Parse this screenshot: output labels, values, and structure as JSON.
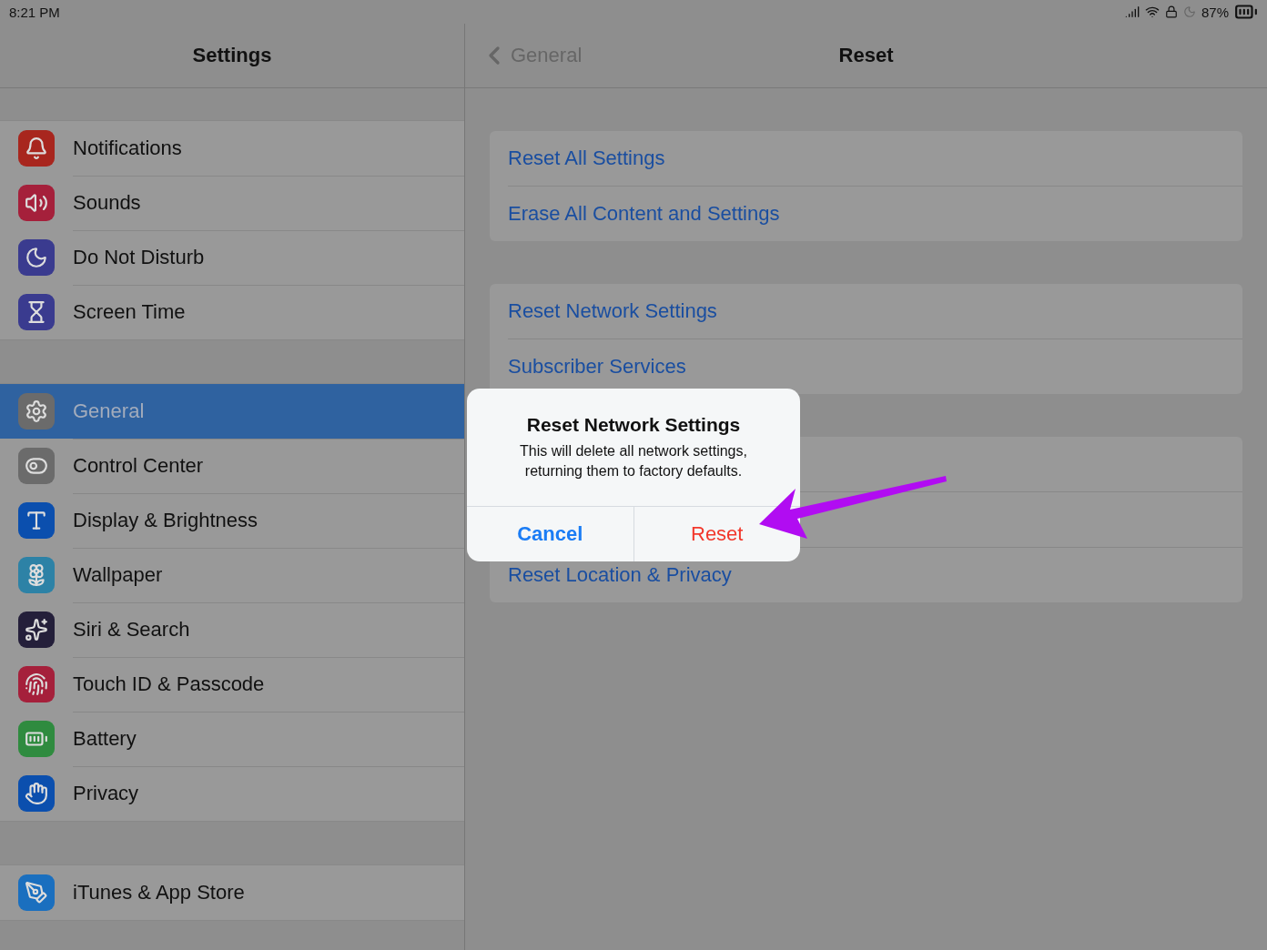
{
  "status_bar": {
    "time": "8:21 PM",
    "battery": "87%"
  },
  "sidebar": {
    "title": "Settings",
    "groups": [
      [
        {
          "label": "Notifications",
          "color": "#a8261e",
          "selected": false
        },
        {
          "label": "Sounds",
          "color": "#a5203b",
          "selected": false
        },
        {
          "label": "Do Not Disturb",
          "color": "#3a3b8f",
          "selected": false
        },
        {
          "label": "Screen Time",
          "color": "#3a3b8f",
          "selected": false
        }
      ],
      [
        {
          "label": "General",
          "color": "#6b6b6b",
          "selected": true
        },
        {
          "label": "Control Center",
          "color": "#6b6b6b",
          "selected": false
        },
        {
          "label": "Display & Brightness",
          "color": "#0b4fae",
          "selected": false
        },
        {
          "label": "Wallpaper",
          "color": "#2d82a6",
          "selected": false
        },
        {
          "label": "Siri & Search",
          "color": "#241f3a",
          "selected": false
        },
        {
          "label": "Touch ID & Passcode",
          "color": "#a5203b",
          "selected": false
        },
        {
          "label": "Battery",
          "color": "#2f8b3f",
          "selected": false
        },
        {
          "label": "Privacy",
          "color": "#0b4fae",
          "selected": false
        }
      ],
      [
        {
          "label": "iTunes & App Store",
          "color": "#1a6fbf",
          "selected": false
        }
      ]
    ]
  },
  "detail": {
    "back": "General",
    "title": "Reset",
    "groups": [
      [
        {
          "label": "Reset All Settings"
        },
        {
          "label": "Erase All Content and Settings"
        }
      ],
      [
        {
          "label": "Reset Network Settings"
        },
        {
          "label": "Subscriber Services"
        }
      ],
      [
        {
          "label": "Reset Location & Privacy"
        }
      ]
    ]
  },
  "alert": {
    "title": "Reset Network Settings",
    "message": "This will delete all network settings, returning them to factory defaults.",
    "buttons": [
      {
        "label": "Cancel",
        "kind": "cancel"
      },
      {
        "label": "Reset",
        "kind": "destructive"
      }
    ]
  }
}
